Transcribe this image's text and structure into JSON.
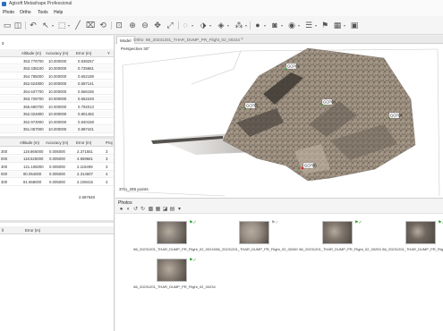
{
  "app": {
    "title": "Agisoft Metashape Professional"
  },
  "menu": {
    "items": [
      "Photo",
      "Ortho",
      "Tools",
      "Help"
    ]
  },
  "cameras_table": {
    "columns": [
      "Altitude (m)",
      "Accuracy (m)",
      "Error (m)",
      "Y"
    ],
    "rows": [
      [
        "353.779700",
        "10.000000",
        "0.838257"
      ],
      [
        "353.436100",
        "10.000000",
        "0.725661"
      ],
      [
        "354.785000",
        "10.000000",
        "0.652189"
      ],
      [
        "352.624800",
        "10.000000",
        "0.587141"
      ],
      [
        "354.637700",
        "10.000000",
        "0.566165"
      ],
      [
        "353.729700",
        "10.000000",
        "0.662249"
      ],
      [
        "355.690700",
        "10.000000",
        "0.792013"
      ],
      [
        "352.024800",
        "10.000000",
        "0.801482"
      ],
      [
        "352.973000",
        "10.000000",
        "0.840158"
      ],
      [
        "351.057000",
        "10.000000",
        "0.887421"
      ]
    ]
  },
  "markers_table": {
    "columns": [
      "Altitude (m)",
      "Accuracy (m)",
      "Error (m)",
      "Proj"
    ],
    "rows": [
      [
        "300",
        "119.866000",
        "0.005000",
        "2.371651",
        "3"
      ],
      [
        "000",
        "118.525000",
        "0.005000",
        "4.559661",
        "3"
      ],
      [
        "300",
        "121.106000",
        "0.005000",
        "2.119499",
        "3"
      ],
      [
        "000",
        "80.054000",
        "0.005000",
        "2.314607",
        "4"
      ],
      [
        "300",
        "81.658000",
        "0.005000",
        "2.108415",
        "4"
      ]
    ],
    "total_error": "2.697648"
  },
  "scalebars_table": {
    "columns": [
      "Error (m)"
    ],
    "first_col_suffix": "ll"
  },
  "tabs": [
    {
      "label": "Model"
    },
    {
      "label": "Ortho"
    },
    {
      "label": "86_20231201_THAR_DUMP_PR_Flight_02_00234"
    }
  ],
  "viewport": {
    "projection": "Perspective 30°",
    "points_count": "37m_285 points",
    "markers": [
      "GCP01",
      "GCP02",
      "GCP03",
      "GCP04",
      "GCP05"
    ]
  },
  "photos": {
    "title": "Photos",
    "items": [
      {
        "caption": "86_20231201_THAR_DUMP_PR_Flight_02_00218",
        "flag_color": "#2a9d2a",
        "check": "✓"
      },
      {
        "caption": "86_20231201_THAR_DUMP_PR_Flight_02_00260",
        "flag_color": "#9a9a9a",
        "check": "✓"
      },
      {
        "caption": "86_20231201_THAR_DUMP_PR_Flight_02_00253",
        "flag_color": "#2a9d2a",
        "check": "✓"
      },
      {
        "caption": "86_20231201_THAR_DUMP_PR_Flight_02_00219",
        "flag_color": "#2a9d2a",
        "check": "✓"
      },
      {
        "caption": "86_20231201_THAR_DUMP_PR_Flight_02_00234",
        "flag_color": "#2a9d2a",
        "check": "✓"
      }
    ]
  },
  "icons": {
    "toolbar": [
      "open-icon",
      "save-icon",
      "undo-icon",
      "redo-icon",
      "navigation-icon",
      "select-icon",
      "ruler-icon",
      "crop-icon",
      "zoom-in-icon",
      "zoom-out-icon",
      "move-icon",
      "rotate-icon",
      "fit-view-icon",
      "region-icon",
      "dense-cloud-icon",
      "model-icon",
      "texture-icon",
      "camera-icon",
      "marker-icon",
      "list-icon",
      "shape-icon",
      "image-icon"
    ]
  }
}
